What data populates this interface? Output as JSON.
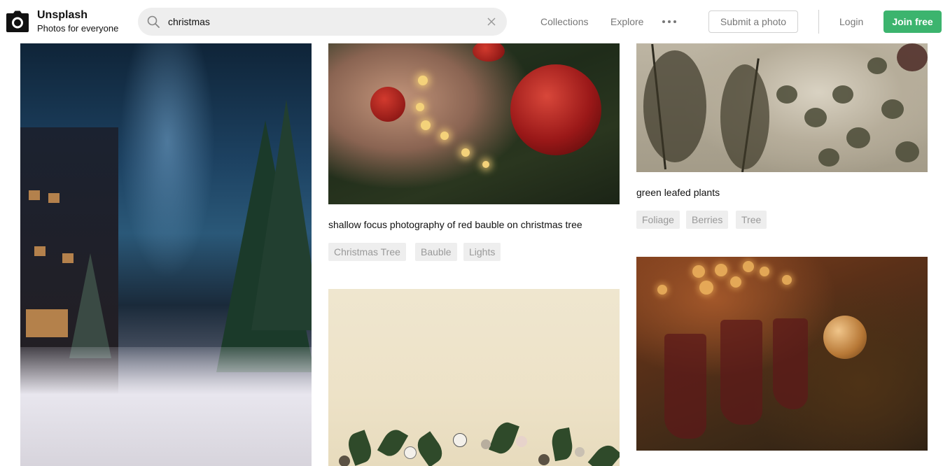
{
  "brand": {
    "name": "Unsplash",
    "tagline": "Photos for everyone",
    "logo_icon": "camera-icon"
  },
  "search": {
    "value": "christmas",
    "icon": "search-icon",
    "clear_icon": "close-icon"
  },
  "nav": {
    "collections": "Collections",
    "explore": "Explore",
    "more_icon": "more-horizontal-icon",
    "submit": "Submit a photo",
    "login": "Login",
    "join": "Join free"
  },
  "colors": {
    "accent_green": "#3cb46e",
    "tag_bg": "#eeeeee",
    "tag_text": "#999999",
    "nav_text": "#777777"
  },
  "photos": [
    {
      "subject": "snowy street with christmas trees at night",
      "caption": "",
      "tags": []
    },
    {
      "subject": "red bauble on christmas tree",
      "caption": "shallow focus photography of red bauble on christmas tree",
      "tags": [
        "Christmas Tree",
        "Bauble",
        "Lights"
      ]
    },
    {
      "subject": "green leafed plants",
      "caption": "green leafed plants",
      "tags": [
        "Foliage",
        "Berries",
        "Tree"
      ]
    },
    {
      "subject": "flat lay of leaves and ornaments",
      "caption": "",
      "tags": []
    },
    {
      "subject": "stockings and ornament by fireplace",
      "caption": "",
      "tags": []
    }
  ]
}
